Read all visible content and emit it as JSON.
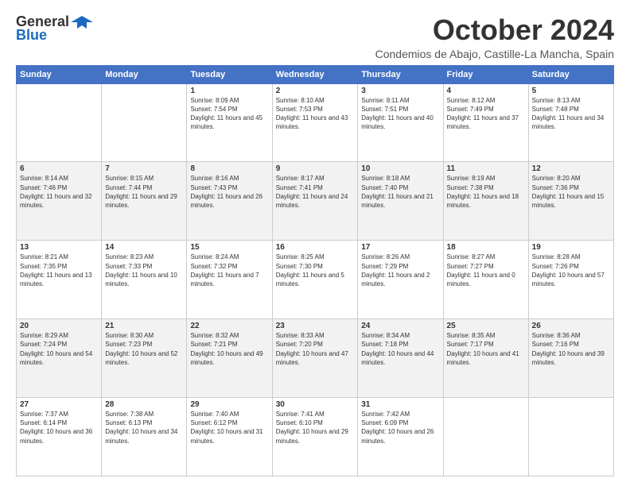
{
  "header": {
    "logo_line1": "General",
    "logo_line2": "Blue",
    "month_title": "October 2024",
    "location": "Condemios de Abajo, Castille-La Mancha, Spain"
  },
  "weekdays": [
    "Sunday",
    "Monday",
    "Tuesday",
    "Wednesday",
    "Thursday",
    "Friday",
    "Saturday"
  ],
  "weeks": [
    [
      {
        "day": "",
        "info": ""
      },
      {
        "day": "",
        "info": ""
      },
      {
        "day": "1",
        "info": "Sunrise: 8:09 AM\nSunset: 7:54 PM\nDaylight: 11 hours and 45 minutes."
      },
      {
        "day": "2",
        "info": "Sunrise: 8:10 AM\nSunset: 7:53 PM\nDaylight: 11 hours and 43 minutes."
      },
      {
        "day": "3",
        "info": "Sunrise: 8:11 AM\nSunset: 7:51 PM\nDaylight: 11 hours and 40 minutes."
      },
      {
        "day": "4",
        "info": "Sunrise: 8:12 AM\nSunset: 7:49 PM\nDaylight: 11 hours and 37 minutes."
      },
      {
        "day": "5",
        "info": "Sunrise: 8:13 AM\nSunset: 7:48 PM\nDaylight: 11 hours and 34 minutes."
      }
    ],
    [
      {
        "day": "6",
        "info": "Sunrise: 8:14 AM\nSunset: 7:46 PM\nDaylight: 11 hours and 32 minutes."
      },
      {
        "day": "7",
        "info": "Sunrise: 8:15 AM\nSunset: 7:44 PM\nDaylight: 11 hours and 29 minutes."
      },
      {
        "day": "8",
        "info": "Sunrise: 8:16 AM\nSunset: 7:43 PM\nDaylight: 11 hours and 26 minutes."
      },
      {
        "day": "9",
        "info": "Sunrise: 8:17 AM\nSunset: 7:41 PM\nDaylight: 11 hours and 24 minutes."
      },
      {
        "day": "10",
        "info": "Sunrise: 8:18 AM\nSunset: 7:40 PM\nDaylight: 11 hours and 21 minutes."
      },
      {
        "day": "11",
        "info": "Sunrise: 8:19 AM\nSunset: 7:38 PM\nDaylight: 11 hours and 18 minutes."
      },
      {
        "day": "12",
        "info": "Sunrise: 8:20 AM\nSunset: 7:36 PM\nDaylight: 11 hours and 15 minutes."
      }
    ],
    [
      {
        "day": "13",
        "info": "Sunrise: 8:21 AM\nSunset: 7:35 PM\nDaylight: 11 hours and 13 minutes."
      },
      {
        "day": "14",
        "info": "Sunrise: 8:23 AM\nSunset: 7:33 PM\nDaylight: 11 hours and 10 minutes."
      },
      {
        "day": "15",
        "info": "Sunrise: 8:24 AM\nSunset: 7:32 PM\nDaylight: 11 hours and 7 minutes."
      },
      {
        "day": "16",
        "info": "Sunrise: 8:25 AM\nSunset: 7:30 PM\nDaylight: 11 hours and 5 minutes."
      },
      {
        "day": "17",
        "info": "Sunrise: 8:26 AM\nSunset: 7:29 PM\nDaylight: 11 hours and 2 minutes."
      },
      {
        "day": "18",
        "info": "Sunrise: 8:27 AM\nSunset: 7:27 PM\nDaylight: 11 hours and 0 minutes."
      },
      {
        "day": "19",
        "info": "Sunrise: 8:28 AM\nSunset: 7:26 PM\nDaylight: 10 hours and 57 minutes."
      }
    ],
    [
      {
        "day": "20",
        "info": "Sunrise: 8:29 AM\nSunset: 7:24 PM\nDaylight: 10 hours and 54 minutes."
      },
      {
        "day": "21",
        "info": "Sunrise: 8:30 AM\nSunset: 7:23 PM\nDaylight: 10 hours and 52 minutes."
      },
      {
        "day": "22",
        "info": "Sunrise: 8:32 AM\nSunset: 7:21 PM\nDaylight: 10 hours and 49 minutes."
      },
      {
        "day": "23",
        "info": "Sunrise: 8:33 AM\nSunset: 7:20 PM\nDaylight: 10 hours and 47 minutes."
      },
      {
        "day": "24",
        "info": "Sunrise: 8:34 AM\nSunset: 7:18 PM\nDaylight: 10 hours and 44 minutes."
      },
      {
        "day": "25",
        "info": "Sunrise: 8:35 AM\nSunset: 7:17 PM\nDaylight: 10 hours and 41 minutes."
      },
      {
        "day": "26",
        "info": "Sunrise: 8:36 AM\nSunset: 7:16 PM\nDaylight: 10 hours and 39 minutes."
      }
    ],
    [
      {
        "day": "27",
        "info": "Sunrise: 7:37 AM\nSunset: 6:14 PM\nDaylight: 10 hours and 36 minutes."
      },
      {
        "day": "28",
        "info": "Sunrise: 7:38 AM\nSunset: 6:13 PM\nDaylight: 10 hours and 34 minutes."
      },
      {
        "day": "29",
        "info": "Sunrise: 7:40 AM\nSunset: 6:12 PM\nDaylight: 10 hours and 31 minutes."
      },
      {
        "day": "30",
        "info": "Sunrise: 7:41 AM\nSunset: 6:10 PM\nDaylight: 10 hours and 29 minutes."
      },
      {
        "day": "31",
        "info": "Sunrise: 7:42 AM\nSunset: 6:09 PM\nDaylight: 10 hours and 26 minutes."
      },
      {
        "day": "",
        "info": ""
      },
      {
        "day": "",
        "info": ""
      }
    ]
  ]
}
